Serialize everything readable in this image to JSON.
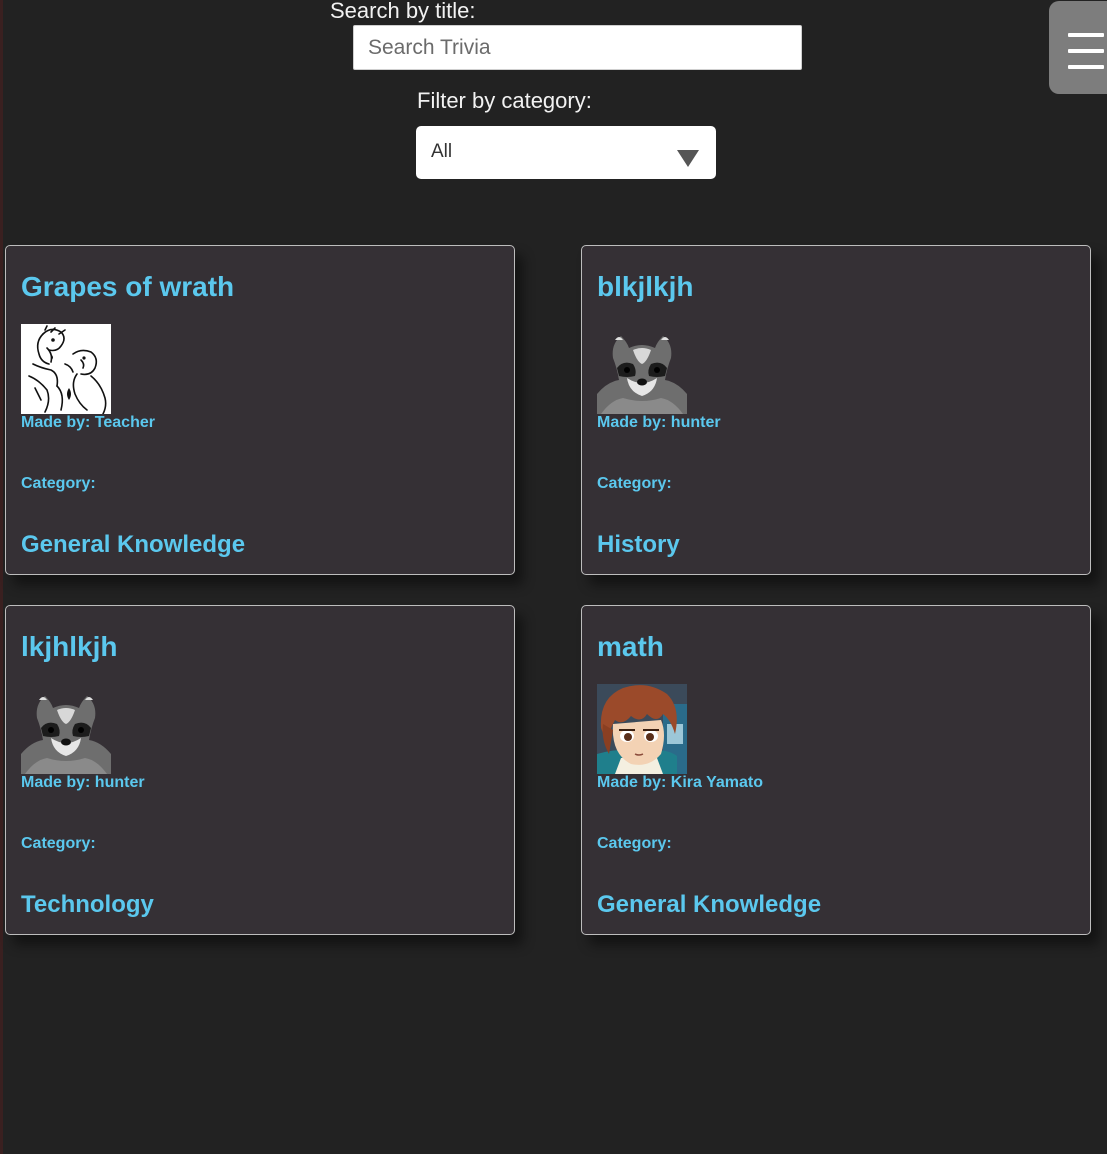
{
  "search": {
    "label": "Search by title:",
    "placeholder": "Search Trivia",
    "value": ""
  },
  "filter": {
    "label": "Filter by category:",
    "selected": "All"
  },
  "menu": {
    "icon": "hamburger-menu-icon"
  },
  "colors": {
    "background": "#222222",
    "card_background": "#353035",
    "accent_text": "#5bc8ee",
    "menu_button": "#7d7d7d"
  },
  "cards": [
    {
      "title": "Grapes of wrath",
      "author": "Made by: Teacher",
      "category_label": "Category:",
      "category": "General Knowledge",
      "avatar": "comic-sketch-avatar"
    },
    {
      "title": "blkjlkjh",
      "author": "Made by: hunter",
      "category_label": "Category:",
      "category": "History",
      "avatar": "raccoon-avatar"
    },
    {
      "title": "lkjhlkjh",
      "author": "Made by: hunter",
      "category_label": "Category:",
      "category": "Technology",
      "avatar": "raccoon-avatar"
    },
    {
      "title": "math",
      "author": "Made by: Kira Yamato",
      "category_label": "Category:",
      "category": "General Knowledge",
      "avatar": "anime-character-avatar"
    }
  ]
}
